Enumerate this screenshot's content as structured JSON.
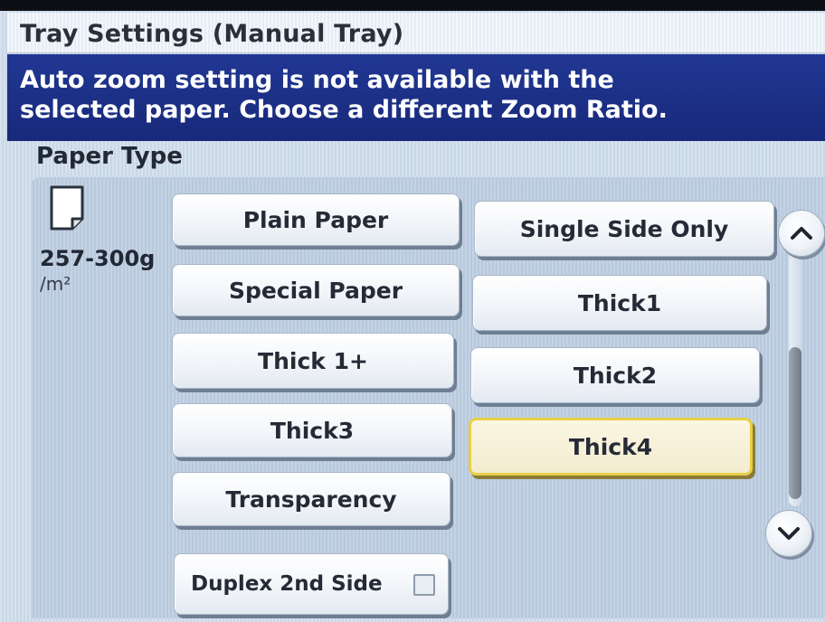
{
  "window": {
    "title": "Tray Settings (Manual Tray)"
  },
  "message": {
    "text": "Auto zoom setting is not available with the\nselected paper. Choose a different Zoom Ratio."
  },
  "paper_type": {
    "label": "Paper Type",
    "weight": "257-300g",
    "unit": "/m²",
    "selected": "Thick4"
  },
  "buttons": {
    "plain_paper": "Plain Paper",
    "special_paper": "Special Paper",
    "thick_1_plus": "Thick 1+",
    "thick3": "Thick3",
    "transparency": "Transparency",
    "single_side_only": "Single Side Only",
    "thick1": "Thick1",
    "thick2": "Thick2",
    "thick4": "Thick4",
    "duplex_2nd_side": "Duplex 2nd Side"
  },
  "options": {
    "duplex_2nd_side_checked": false
  },
  "icons": {
    "paper": "paper-sheet-icon",
    "scroll_up": "chevron-up-icon",
    "scroll_down": "chevron-down-icon"
  },
  "colors": {
    "message_bar": "#1b2f86",
    "selected_border": "#e7cf45"
  }
}
